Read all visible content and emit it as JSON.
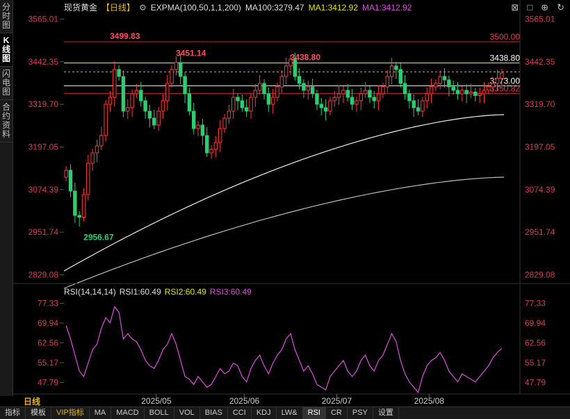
{
  "left_tabs": [
    "分时图",
    "K线图",
    "闪电图",
    "合约资料"
  ],
  "header": {
    "symbol": "现货黄金",
    "period": "【日线】",
    "settings_icon": "gear-icon",
    "expma": "EXPMA(100,50,1,1,200)",
    "ma100": "MA100:3279.47",
    "ma1a": "MA1:3412.92",
    "ma1b": "MA1:3412.92",
    "colors": {
      "symbol": "#dddddd",
      "period": "#e6b800",
      "expma": "#dddddd",
      "ma100": "#dddddd",
      "ma1a": "#e6e600",
      "ma1b": "#d94fd9"
    }
  },
  "top_icons": [
    "close-box-icon",
    "square-icon",
    "crosshair-icon",
    "refresh-icon"
  ],
  "rsi_header": {
    "name": "RSI(14,14,14)",
    "rsi1": "RSI1:60.49",
    "rsi2": "RSI2:60.49",
    "rsi3": "RSI3:60.49"
  },
  "period_footer": "日线",
  "bottom_tabs": [
    "指标",
    "模板",
    "VIP指标",
    "MA",
    "MACD",
    "BOLL",
    "VOL",
    "BIAS",
    "CCI",
    "KDJ",
    "LW&",
    "RSI",
    "CR",
    "PSY",
    "设置"
  ],
  "bottom_active": "RSI",
  "chart_data": [
    {
      "type": "candlestick",
      "y_ticks": [
        "3565.01",
        "3442.35",
        "3319.70",
        "3197.05",
        "3074.39",
        "2951.74",
        "2829.08"
      ],
      "ylim": [
        2800,
        3580
      ],
      "x_ticks": [
        "2025/05",
        "2025/06",
        "2025/07",
        "2025/08"
      ],
      "horizontal_levels": [
        {
          "label": "3500.00",
          "value": 3500.0,
          "color": "#d0202a"
        },
        {
          "label": "3438.80",
          "value": 3438.8,
          "color": "#e8e8c0"
        },
        {
          "label": "3373.00",
          "value": 3373.0,
          "color": "#e8e8e8"
        },
        {
          "label": "3350.82",
          "value": 3350.82,
          "color": "#d0202a"
        }
      ],
      "annotations": [
        {
          "label": "3499.83",
          "value": 3499.83
        },
        {
          "label": "3451.14",
          "value": 3451.14
        },
        {
          "label": "3438.80",
          "value": 3438.8
        },
        {
          "label": "2956.67",
          "value": 2956.67
        }
      ],
      "current_price": 3412.92,
      "closes": [
        3130,
        3070,
        3000,
        2995,
        3060,
        3150,
        3180,
        3200,
        3230,
        3320,
        3340,
        3420,
        3400,
        3300,
        3310,
        3350,
        3360,
        3330,
        3300,
        3280,
        3260,
        3300,
        3330,
        3380,
        3420,
        3440,
        3400,
        3350,
        3300,
        3250,
        3260,
        3230,
        3180,
        3190,
        3210,
        3250,
        3280,
        3300,
        3340,
        3330,
        3310,
        3300,
        3340,
        3360,
        3380,
        3350,
        3320,
        3340,
        3370,
        3400,
        3430,
        3450,
        3400,
        3380,
        3360,
        3370,
        3350,
        3320,
        3310,
        3300,
        3330,
        3340,
        3350,
        3360,
        3340,
        3320,
        3330,
        3350,
        3360,
        3340,
        3330,
        3350,
        3370,
        3400,
        3430,
        3420,
        3380,
        3350,
        3330,
        3310,
        3300,
        3330,
        3350,
        3370,
        3380,
        3400,
        3390,
        3370,
        3360,
        3350,
        3360,
        3350,
        3355,
        3345,
        3350,
        3360,
        3370,
        3380,
        3395,
        3410
      ],
      "ema100_start": 2840,
      "ema100_end": 3290,
      "ema200_start": 2790,
      "ema200_end": 3110
    },
    {
      "type": "line",
      "name": "RSI",
      "y_ticks": [
        "77.33",
        "69.94",
        "62.56",
        "55.17",
        "47.79"
      ],
      "ylim": [
        44.0,
        79.0
      ],
      "values": [
        69,
        64,
        58,
        52,
        50,
        55,
        60,
        62,
        68,
        72,
        70,
        76,
        74,
        64,
        66,
        64,
        63,
        60,
        56,
        54,
        53,
        56,
        60,
        62,
        66,
        62,
        56,
        50,
        49,
        47,
        50,
        48,
        46,
        47,
        50,
        53,
        51,
        52,
        55,
        54,
        50,
        48,
        53,
        56,
        58,
        54,
        51,
        55,
        58,
        60,
        64,
        66,
        60,
        56,
        52,
        54,
        51,
        47,
        46,
        45,
        50,
        52,
        54,
        56,
        52,
        50,
        52,
        56,
        58,
        54,
        52,
        56,
        58,
        62,
        66,
        63,
        56,
        51,
        48,
        46,
        44,
        50,
        54,
        56,
        57,
        59,
        56,
        52,
        50,
        48,
        51,
        50,
        49,
        48,
        50,
        52,
        54,
        57,
        59,
        60.49
      ]
    }
  ]
}
